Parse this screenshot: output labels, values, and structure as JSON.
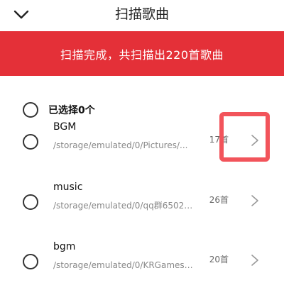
{
  "header": {
    "title": "扫描歌曲",
    "back_icon": "chevron-down-icon"
  },
  "banner": {
    "text": "扫描完成，共扫描出220首歌曲",
    "color": "#e43038"
  },
  "select_all": {
    "label": "已选择0个",
    "checked": false
  },
  "folders": [
    {
      "name": "BGM",
      "path": "/storage/emulated/0/Pictures/...",
      "count": "17首",
      "checked": false
    },
    {
      "name": "music",
      "path": "/storage/emulated/0/qq群65021...",
      "count": "26首",
      "checked": false
    },
    {
      "name": "bgm",
      "path": "/storage/emulated/0/KRGames/...",
      "count": "20首",
      "checked": false
    }
  ],
  "highlight": {
    "color": "#f2545b"
  }
}
